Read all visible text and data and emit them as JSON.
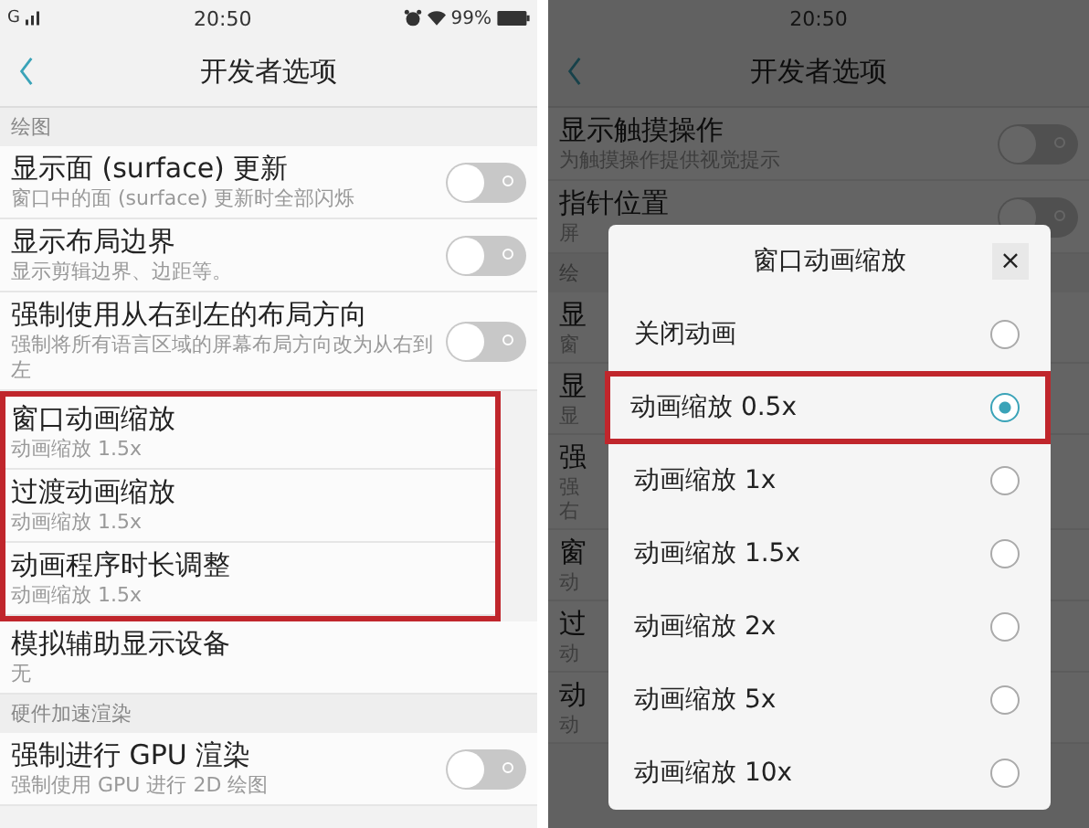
{
  "left_screen": {
    "status_bar": {
      "network": "G",
      "time": "20:50",
      "battery": "99%"
    },
    "header": {
      "title": "开发者选项"
    },
    "list": [
      {
        "kind": "section",
        "title": "绘图"
      },
      {
        "kind": "toggle",
        "title": "显示面 (surface) 更新",
        "subtitle": "窗口中的面 (surface) 更新时全部闪烁",
        "on": false
      },
      {
        "kind": "toggle",
        "title": "显示布局边界",
        "subtitle": "显示剪辑边界、边距等。",
        "on": false
      },
      {
        "kind": "toggle",
        "title": "强制使用从右到左的布局方向",
        "subtitle": "强制将所有语言区域的屏幕布局方向改为从右到左",
        "on": false
      },
      {
        "kind": "highlight_group",
        "items": [
          {
            "kind": "value",
            "title": "窗口动画缩放",
            "subtitle": "动画缩放 1.5x"
          },
          {
            "kind": "value",
            "title": "过渡动画缩放",
            "subtitle": "动画缩放 1.5x"
          },
          {
            "kind": "value",
            "title": "动画程序时长调整",
            "subtitle": "动画缩放 1.5x"
          }
        ]
      },
      {
        "kind": "value",
        "title": "模拟辅助显示设备",
        "subtitle": "无"
      },
      {
        "kind": "section",
        "title": "硬件加速渲染"
      },
      {
        "kind": "toggle",
        "title": "强制进行 GPU 渲染",
        "subtitle": "强制使用 GPU 进行 2D 绘图",
        "on": false
      }
    ]
  },
  "right_screen": {
    "status_bar": {
      "time": "20:50"
    },
    "header": {
      "title": "开发者选项"
    },
    "list": [
      {
        "kind": "toggle",
        "title": "显示触摸操作",
        "subtitle": "为触摸操作提供视觉提示",
        "on": false
      },
      {
        "kind": "toggle",
        "title": "指针位置",
        "subtitle": "屏",
        "on": false
      },
      {
        "kind": "section",
        "title": "绘"
      },
      {
        "kind": "partial",
        "title": "显",
        "subtitle": "窗"
      },
      {
        "kind": "partial",
        "title": "显",
        "subtitle": "显"
      },
      {
        "kind": "partial",
        "title": "强",
        "subtitle": "强右"
      },
      {
        "kind": "partial",
        "title": "窗",
        "subtitle": "动"
      },
      {
        "kind": "partial",
        "title": "过",
        "subtitle": "动"
      },
      {
        "kind": "partial",
        "title": "动",
        "subtitle": "动"
      }
    ],
    "dialog": {
      "title": "窗口动画缩放",
      "close": "×",
      "options": [
        {
          "label": "关闭动画",
          "selected": false,
          "highlighted": false
        },
        {
          "label": "动画缩放 0.5x",
          "selected": true,
          "highlighted": true
        },
        {
          "label": "动画缩放 1x",
          "selected": false,
          "highlighted": false
        },
        {
          "label": "动画缩放 1.5x",
          "selected": false,
          "highlighted": false
        },
        {
          "label": "动画缩放 2x",
          "selected": false,
          "highlighted": false
        },
        {
          "label": "动画缩放 5x",
          "selected": false,
          "highlighted": false
        },
        {
          "label": "动画缩放 10x",
          "selected": false,
          "highlighted": false
        }
      ]
    }
  }
}
